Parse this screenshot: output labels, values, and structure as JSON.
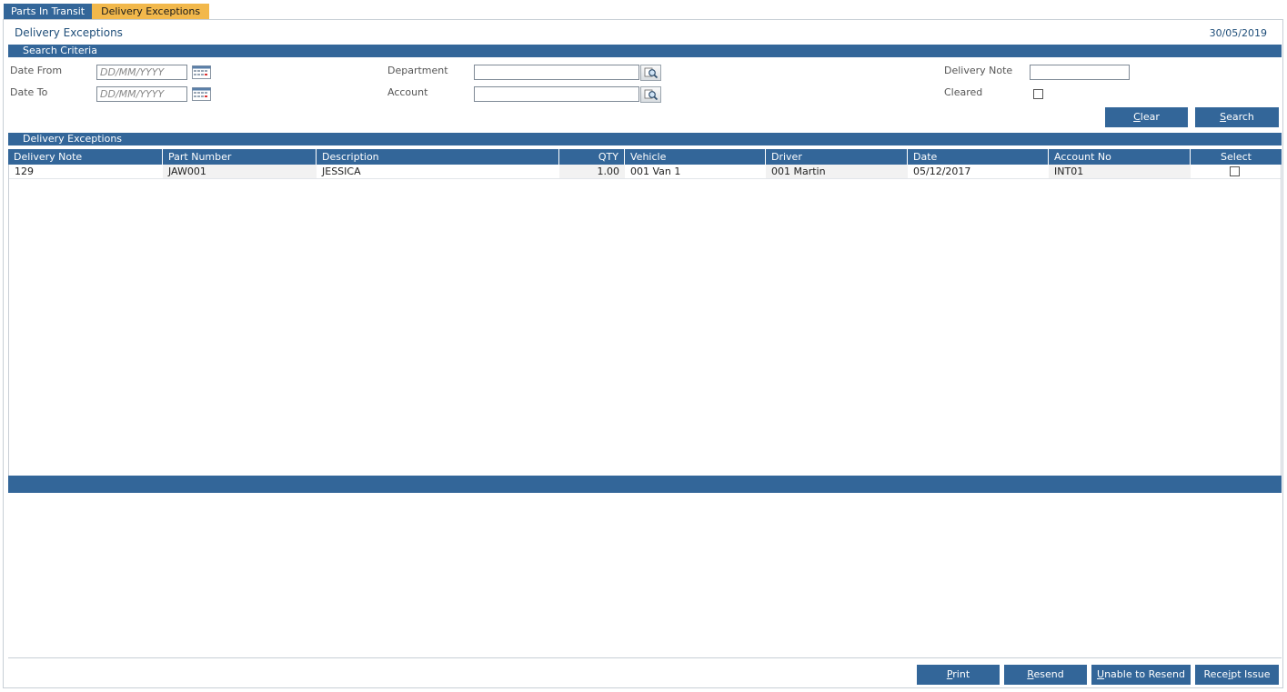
{
  "tabs": [
    {
      "label": "Parts In Transit"
    },
    {
      "label": "Delivery Exceptions"
    }
  ],
  "page": {
    "title": "Delivery Exceptions",
    "date": "30/05/2019"
  },
  "search": {
    "section_title": "Search Criteria",
    "date_from_label": "Date From",
    "date_to_label": "Date To",
    "date_placeholder": "DD/MM/YYYY",
    "department_label": "Department",
    "account_label": "Account",
    "delivery_note_label": "Delivery Note",
    "cleared_label": "Cleared",
    "cleared_checked": false,
    "clear_button": {
      "mnemonic": "C",
      "rest": "lear"
    },
    "search_button": {
      "mnemonic": "S",
      "rest": "earch"
    }
  },
  "grid": {
    "section_title": "Delivery Exceptions",
    "columns": [
      "Delivery Note",
      "Part Number",
      "Description",
      "QTY",
      "Vehicle",
      "Driver",
      "Date",
      "Account No",
      "Select"
    ],
    "rows": [
      {
        "delivery_note": "129",
        "part_number": "JAW001",
        "description": "JESSICA",
        "qty": "1.00",
        "vehicle": "001 Van 1",
        "driver": "001 Martin",
        "date": "05/12/2017",
        "account_no": "INT01",
        "selected": false
      }
    ]
  },
  "actions": {
    "print": {
      "mnemonic": "P",
      "rest": "rint"
    },
    "resend": {
      "mnemonic": "R",
      "rest": "esend"
    },
    "unable": {
      "mnemonic": "U",
      "rest": "nable to Resend"
    },
    "receipt": {
      "pre": "Rece",
      "mnemonic": "i",
      "rest": "pt Issue"
    }
  },
  "colors": {
    "primary": "#336699",
    "active_tab": "#f2b84b",
    "title": "#1f4e79"
  }
}
